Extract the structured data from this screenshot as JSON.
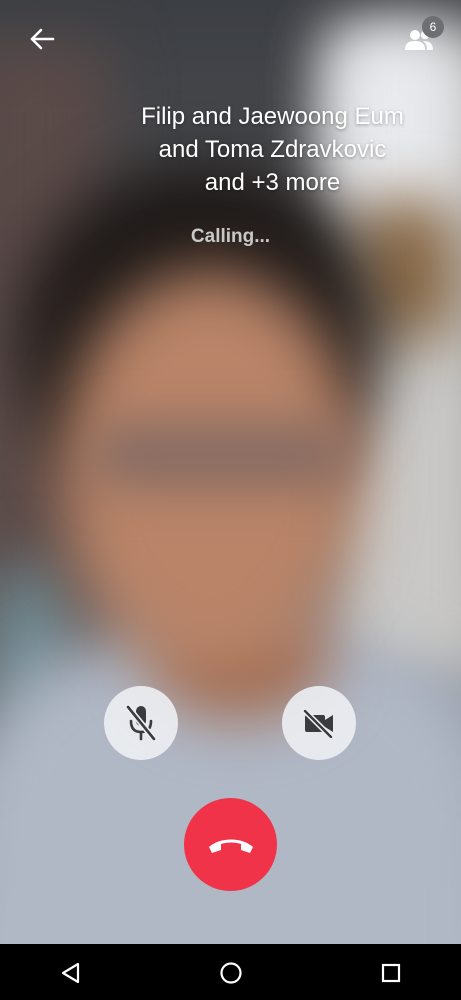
{
  "call": {
    "title": "Filip and Jaewoong Eum\nand Toma Zdravkovic\nand +3 more",
    "status": "Calling..."
  },
  "participants": {
    "count": "6",
    "icon": "people-icon"
  },
  "controls": {
    "mute_icon": "mic-off-icon",
    "video_icon": "videocam-off-icon",
    "end_icon": "call-end-icon"
  },
  "navbar": {
    "back_icon": "triangle-back-icon",
    "home_icon": "circle-home-icon",
    "recent_icon": "square-recent-icon"
  },
  "colors": {
    "end_call": "#f03348",
    "control_bg": "#eceef2",
    "badge": "#6d6f73",
    "status_text": "#c8c8c8"
  }
}
